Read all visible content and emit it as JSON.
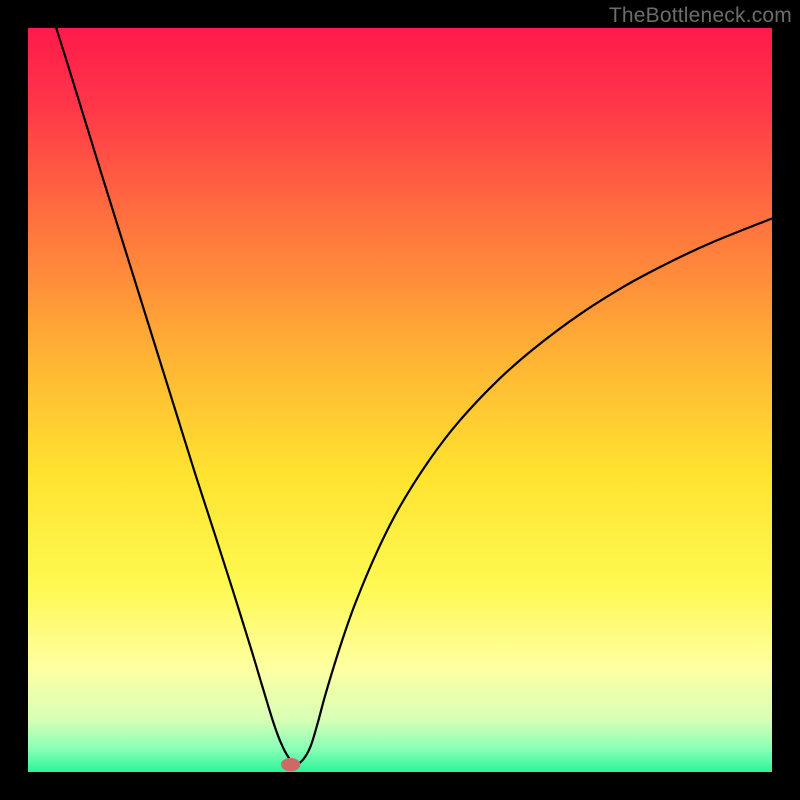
{
  "watermark": "TheBottleneck.com",
  "chart_data": {
    "type": "line",
    "title": "",
    "xlabel": "",
    "ylabel": "",
    "xlim": [
      0,
      100
    ],
    "ylim": [
      0,
      100
    ],
    "background_gradient": {
      "stops": [
        {
          "offset": 0.0,
          "color": "#ff1a4b"
        },
        {
          "offset": 0.1,
          "color": "#ff3549"
        },
        {
          "offset": 0.25,
          "color": "#ff6e3f"
        },
        {
          "offset": 0.45,
          "color": "#ffb634"
        },
        {
          "offset": 0.6,
          "color": "#ffe32f"
        },
        {
          "offset": 0.75,
          "color": "#fef952"
        },
        {
          "offset": 0.86,
          "color": "#feffa1"
        },
        {
          "offset": 0.93,
          "color": "#d7ffb6"
        },
        {
          "offset": 0.97,
          "color": "#86ffb6"
        },
        {
          "offset": 1.0,
          "color": "#2bf49a"
        }
      ]
    },
    "series": [
      {
        "name": "bottleneck-curve",
        "x": [
          3.8,
          5,
          7.5,
          10,
          12.5,
          15,
          17.5,
          20,
          22.5,
          25,
          27.5,
          30,
          31.5,
          33,
          34,
          35,
          36,
          37,
          38,
          39,
          40,
          42,
          44,
          47,
          50,
          54,
          58,
          63,
          68,
          74,
          80,
          86,
          92,
          100
        ],
        "y": [
          100,
          96.2,
          88.1,
          80,
          72,
          64,
          56,
          48,
          40,
          32.3,
          24.5,
          16.5,
          11.5,
          6.6,
          3.9,
          2.0,
          1.1,
          1.7,
          3.5,
          6.8,
          10.5,
          17,
          22.7,
          29.8,
          35.7,
          42,
          47.2,
          52.5,
          56.9,
          61.4,
          65.2,
          68.4,
          71.2,
          74.4
        ]
      }
    ],
    "marker": {
      "name": "optimal-point",
      "x": 35.3,
      "y": 1.0,
      "rx": 1.3,
      "ry": 0.9,
      "color": "#cd6a66"
    }
  }
}
